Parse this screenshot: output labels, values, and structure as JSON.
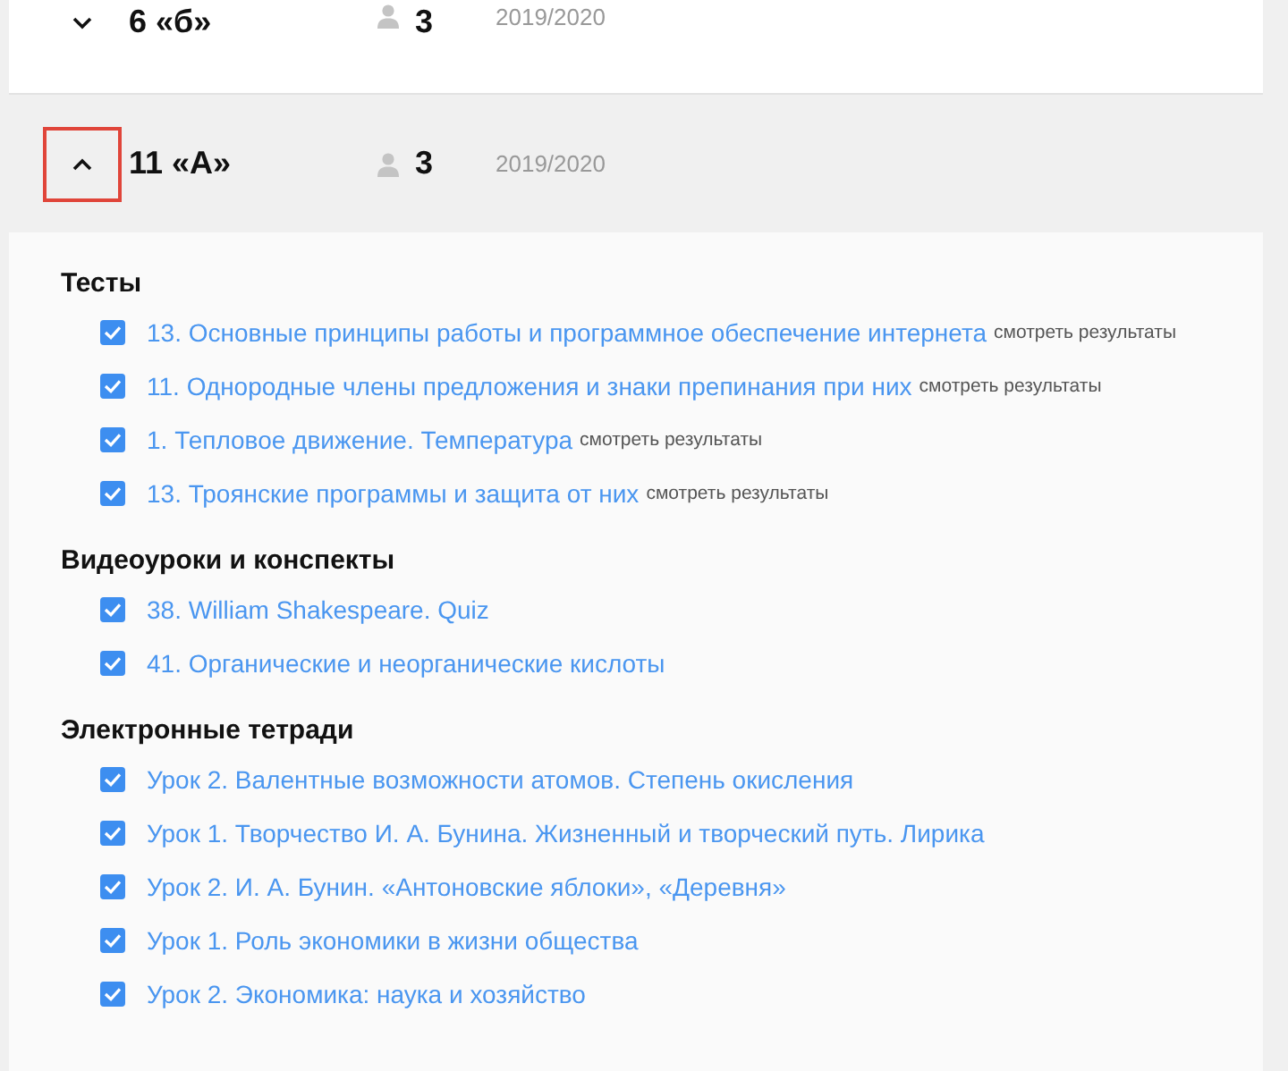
{
  "classes": [
    {
      "name": "6 «б»",
      "students": "3",
      "year": "2019/2020",
      "expanded": false,
      "focused": false
    },
    {
      "name": "11 «А»",
      "students": "3",
      "year": "2019/2020",
      "expanded": true,
      "focused": true,
      "sections": [
        {
          "title": "Тесты",
          "items": [
            {
              "title": "13. Основные принципы работы и программное обеспечение интернета",
              "checked": true,
              "results_link": "смотреть результаты"
            },
            {
              "title": "11. Однородные члены предложения и знаки препинания при них",
              "checked": true,
              "results_link": "смотреть результаты"
            },
            {
              "title": "1. Тепловое движение. Температура",
              "checked": true,
              "results_link": "смотреть результаты"
            },
            {
              "title": "13. Троянские программы и защита от них",
              "checked": true,
              "results_link": "смотреть результаты"
            }
          ]
        },
        {
          "title": "Видеоуроки и конспекты",
          "items": [
            {
              "title": "38. William Shakespeare. Quiz",
              "checked": true
            },
            {
              "title": "41. Органические и неорганические кислоты",
              "checked": true
            }
          ]
        },
        {
          "title": "Электронные тетради",
          "items": [
            {
              "title": "Урок 2. Валентные возможности атомов. Степень окисления",
              "checked": true
            },
            {
              "title": "Урок 1. Творчество И. А. Бунина. Жизненный и творческий путь. Лирика",
              "checked": true
            },
            {
              "title": "Урок 2. И. А. Бунин. «Антоновские яблоки», «Деревня»",
              "checked": true
            },
            {
              "title": "Урок 1. Роль экономики в жизни общества",
              "checked": true
            },
            {
              "title": "Урок 2. Экономика: наука и хозяйство",
              "checked": true
            }
          ]
        }
      ]
    }
  ]
}
